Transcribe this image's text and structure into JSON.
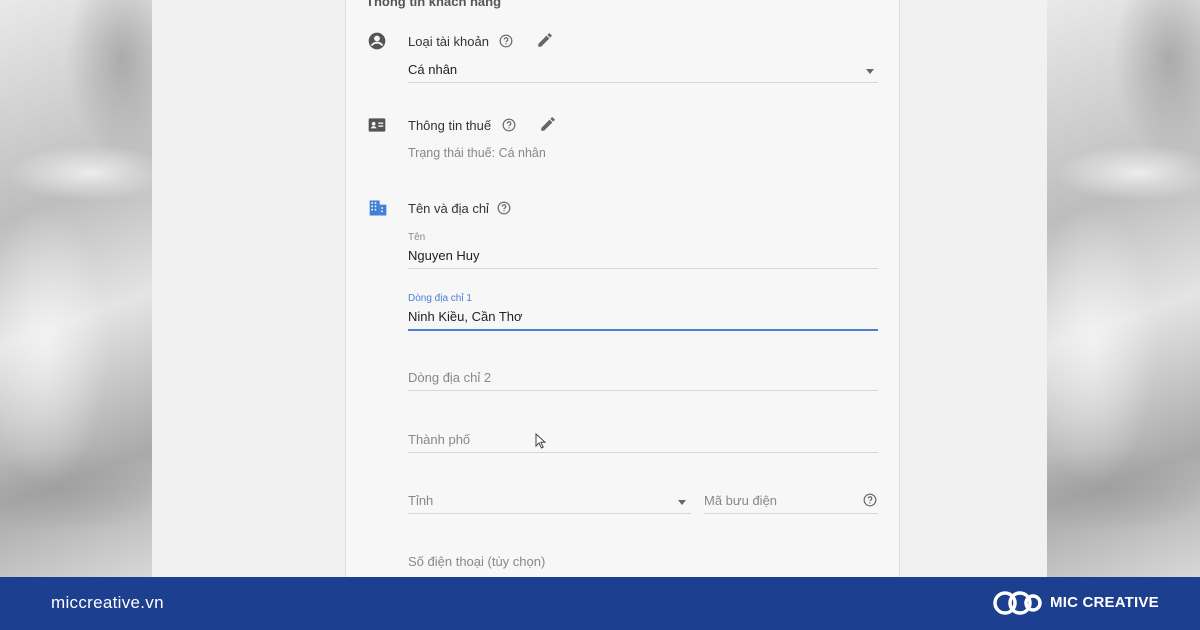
{
  "form": {
    "section_title": "Thông tin khách hàng",
    "account_type": {
      "label": "Loại tài khoản",
      "value": "Cá nhân"
    },
    "tax_info": {
      "label": "Thông tin thuế",
      "status": "Trạng thái thuế: Cá nhân"
    },
    "name_address": {
      "label": "Tên và địa chỉ",
      "name_label": "Tên",
      "name_value": "Nguyen Huy",
      "address1_label": "Dòng địa chỉ 1",
      "address1_value": "Ninh Kiều, Cần Thơ",
      "address2_placeholder": "Dòng địa chỉ 2",
      "city_placeholder": "Thành phố",
      "province_placeholder": "Tỉnh",
      "postal_placeholder": "Mã bưu điện",
      "phone_placeholder": "Số điện thoại (tùy chọn)"
    }
  },
  "footer": {
    "site": "miccreative.vn",
    "brand": "MIC CREATIVE"
  },
  "colors": {
    "footer_bg": "#1d3f8f",
    "accent_blue": "#4a7fd4",
    "building_icon": "#3f7fd9"
  }
}
